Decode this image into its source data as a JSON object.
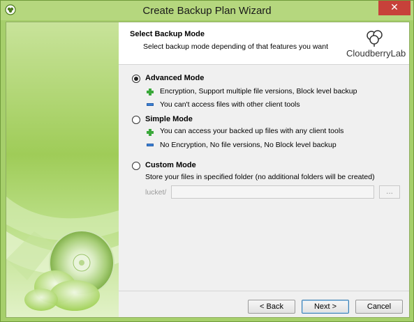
{
  "window": {
    "title": "Create Backup Plan Wizard",
    "close_glyph": "✕",
    "accent_color": "#c7413a",
    "app_icon": "cloudberry-app-icon"
  },
  "header": {
    "title": "Select Backup Mode",
    "subtitle": "Select backup mode depending of that features you want",
    "logo_text": "CloudberryLab",
    "logo_icon": "cloudberry-logo-icon"
  },
  "modes": {
    "advanced": {
      "label": "Advanced Mode",
      "selected": true,
      "features": [
        {
          "type": "plus",
          "text": "Encryption, Support multiple file versions, Block level backup"
        },
        {
          "type": "minus",
          "text": "You can't access files with other client tools"
        }
      ]
    },
    "simple": {
      "label": "Simple Mode",
      "selected": false,
      "features": [
        {
          "type": "plus",
          "text": "You can access your backed up files with any client tools"
        },
        {
          "type": "minus",
          "text": "No Encryption, No file versions, No Block level backup"
        }
      ]
    },
    "custom": {
      "label": "Custom Mode",
      "selected": false,
      "description": "Store your files in specified folder (no additional folders will be created)",
      "path_prefix": "lucket/",
      "path_value": "",
      "browse_label": "...",
      "enabled": false
    }
  },
  "buttons": {
    "back": "< Back",
    "next": "Next >",
    "cancel": "Cancel"
  }
}
